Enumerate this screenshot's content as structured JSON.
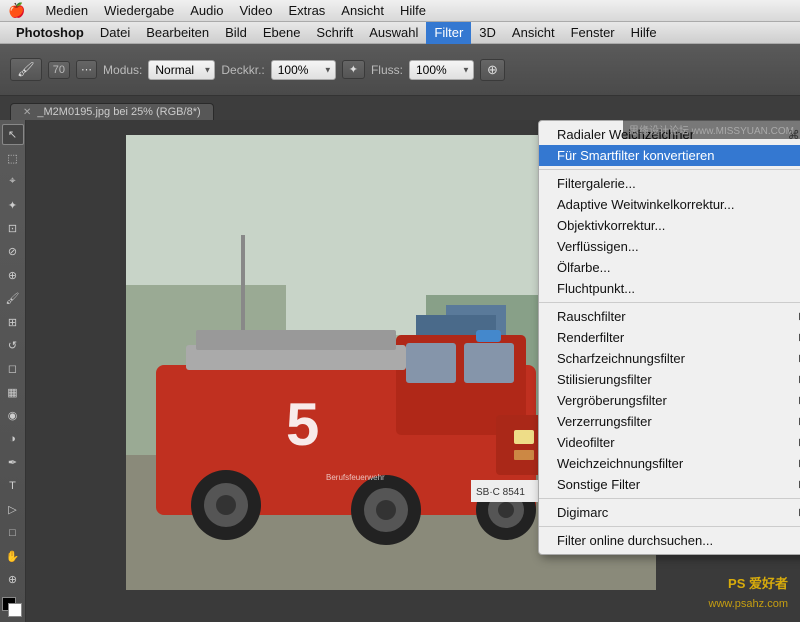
{
  "app": {
    "name": "Photoshop",
    "site_label": "思缘设计论坛 www.MISSYUAN.COM"
  },
  "menubar": {
    "apple": "🍎",
    "items": [
      {
        "label": "Medien",
        "active": false
      },
      {
        "label": "Wiedergabe",
        "active": false
      },
      {
        "label": "Audio",
        "active": false
      },
      {
        "label": "Video",
        "active": false
      },
      {
        "label": "Extras",
        "active": false
      },
      {
        "label": "Ansicht",
        "active": false
      },
      {
        "label": "Hilfe",
        "active": false
      }
    ],
    "app_items": [
      {
        "label": "Photoshop",
        "active": false,
        "bold": true
      },
      {
        "label": "Datei",
        "active": false
      },
      {
        "label": "Bearbeiten",
        "active": false
      },
      {
        "label": "Bild",
        "active": false
      },
      {
        "label": "Ebene",
        "active": false
      },
      {
        "label": "Schrift",
        "active": false
      },
      {
        "label": "Auswahl",
        "active": false
      },
      {
        "label": "Filter",
        "active": true
      },
      {
        "label": "3D",
        "active": false
      },
      {
        "label": "Ansicht",
        "active": false
      },
      {
        "label": "Fenster",
        "active": false
      },
      {
        "label": "Hilfe",
        "active": false
      }
    ]
  },
  "toolbar": {
    "brush_size": "70",
    "mode_label": "Modus:",
    "mode_value": "Normal",
    "opacity_label": "Deckkr.:",
    "opacity_value": "100%",
    "flow_label": "Fluss:",
    "flow_value": "100"
  },
  "tab": {
    "title": "_M2M0195.jpg bei 25% (RGB/8*)"
  },
  "dropdown": {
    "title": "Filter",
    "sections": [
      {
        "items": [
          {
            "label": "Radialer Weichzeichner",
            "shortcut": "⌘F",
            "arrow": false,
            "highlighted": false
          },
          {
            "label": "Für Smartfilter konvertieren",
            "shortcut": "",
            "arrow": false,
            "highlighted": true
          }
        ]
      },
      {
        "items": [
          {
            "label": "Filtergalerie...",
            "shortcut": "",
            "arrow": false,
            "highlighted": false
          },
          {
            "label": "Adaptive Weitwinkelkorrektur...",
            "shortcut": "",
            "arrow": false,
            "highlighted": false
          },
          {
            "label": "Objektivkorrektur...",
            "shortcut": "",
            "arrow": false,
            "highlighted": false
          },
          {
            "label": "Verflüssigen...",
            "shortcut": "",
            "arrow": false,
            "highlighted": false
          },
          {
            "label": "Ölfarbe...",
            "shortcut": "",
            "arrow": false,
            "highlighted": false
          },
          {
            "label": "Fluchtpunkt...",
            "shortcut": "",
            "arrow": false,
            "highlighted": false
          }
        ]
      },
      {
        "items": [
          {
            "label": "Rauschfilter",
            "shortcut": "",
            "arrow": true,
            "highlighted": false
          },
          {
            "label": "Renderfilter",
            "shortcut": "",
            "arrow": true,
            "highlighted": false
          },
          {
            "label": "Scharfzeichnungsfilter",
            "shortcut": "",
            "arrow": true,
            "highlighted": false
          },
          {
            "label": "Stilisierungsfilter",
            "shortcut": "",
            "arrow": true,
            "highlighted": false
          },
          {
            "label": "Vergröberungsfilter",
            "shortcut": "",
            "arrow": true,
            "highlighted": false
          },
          {
            "label": "Verzerrungsfilter",
            "shortcut": "",
            "arrow": true,
            "highlighted": false
          },
          {
            "label": "Videofilter",
            "shortcut": "",
            "arrow": true,
            "highlighted": false
          },
          {
            "label": "Weichzeichnungsfilter",
            "shortcut": "",
            "arrow": true,
            "highlighted": false
          },
          {
            "label": "Sonstige Filter",
            "shortcut": "",
            "arrow": true,
            "highlighted": false
          }
        ]
      },
      {
        "items": [
          {
            "label": "Digimarc",
            "shortcut": "",
            "arrow": true,
            "highlighted": false
          }
        ]
      },
      {
        "items": [
          {
            "label": "Filter online durchsuchen...",
            "shortcut": "",
            "arrow": false,
            "highlighted": false
          }
        ]
      }
    ]
  },
  "watermark": {
    "top": "PS 爱好者",
    "bottom": "www.psahz.com"
  }
}
